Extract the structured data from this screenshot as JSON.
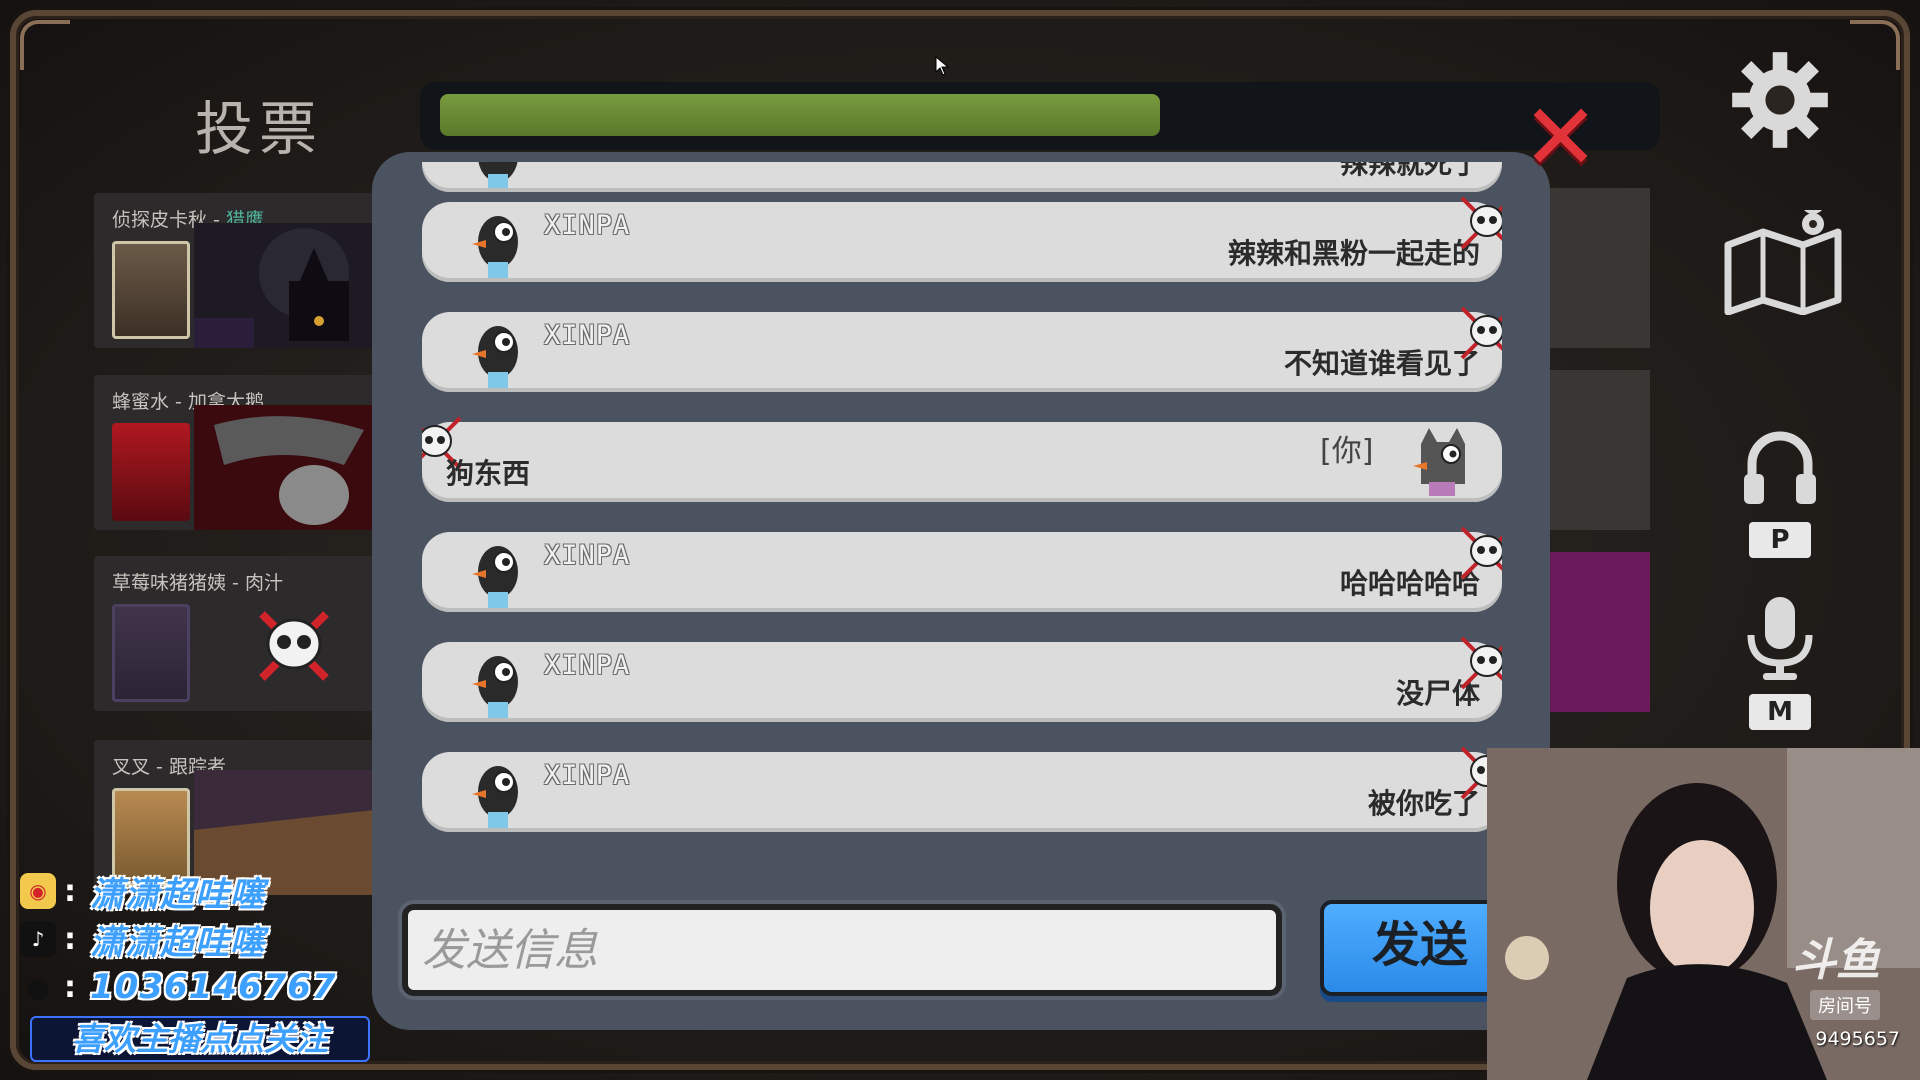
{
  "vote": {
    "title": "投票",
    "timer_progress": 0.6
  },
  "players": [
    {
      "name": "侦探皮卡秋",
      "role": "猎鹰",
      "role_color": "#4fb59a",
      "dead": false
    },
    {
      "name": "蜂蜜水",
      "role": "加拿大鹅",
      "dead": false
    },
    {
      "name": "草莓味猪猪姨",
      "role": "肉汁",
      "dead": true
    },
    {
      "name": "叉叉",
      "role": "跟踪者",
      "dead": false
    }
  ],
  "chat": {
    "messages": [
      {
        "sender": "",
        "text": "辣辣就死了",
        "mine": false
      },
      {
        "sender": "XINPA",
        "text": "辣辣和黑粉一起走的",
        "mine": false
      },
      {
        "sender": "XINPA",
        "text": "不知道谁看见了",
        "mine": false
      },
      {
        "sender": "",
        "you_tag": "[你]",
        "text": "狗东西",
        "mine": true
      },
      {
        "sender": "XINPA",
        "text": "哈哈哈哈哈",
        "mine": false
      },
      {
        "sender": "XINPA",
        "text": "没尸体",
        "mine": false
      },
      {
        "sender": "XINPA",
        "text": "被你吃了",
        "mine": false
      }
    ],
    "input_placeholder": "发送信息",
    "send_label": "发送"
  },
  "controls": {
    "push_to_talk_key": "P",
    "mic_key": "M"
  },
  "overlay": {
    "weibo": "潇潇超哇噻",
    "douyin": "潇潇超哇噻",
    "qq": "1036146767",
    "colon": ":",
    "follow": "喜欢主播点点关注",
    "room_label": "房间号",
    "room_id": "9495657",
    "platform_logo": "斗鱼"
  },
  "colors": {
    "timer": "#6b8a33",
    "close": "#e2333a",
    "send": "#3a9cf5",
    "panel": "#4b5260"
  }
}
